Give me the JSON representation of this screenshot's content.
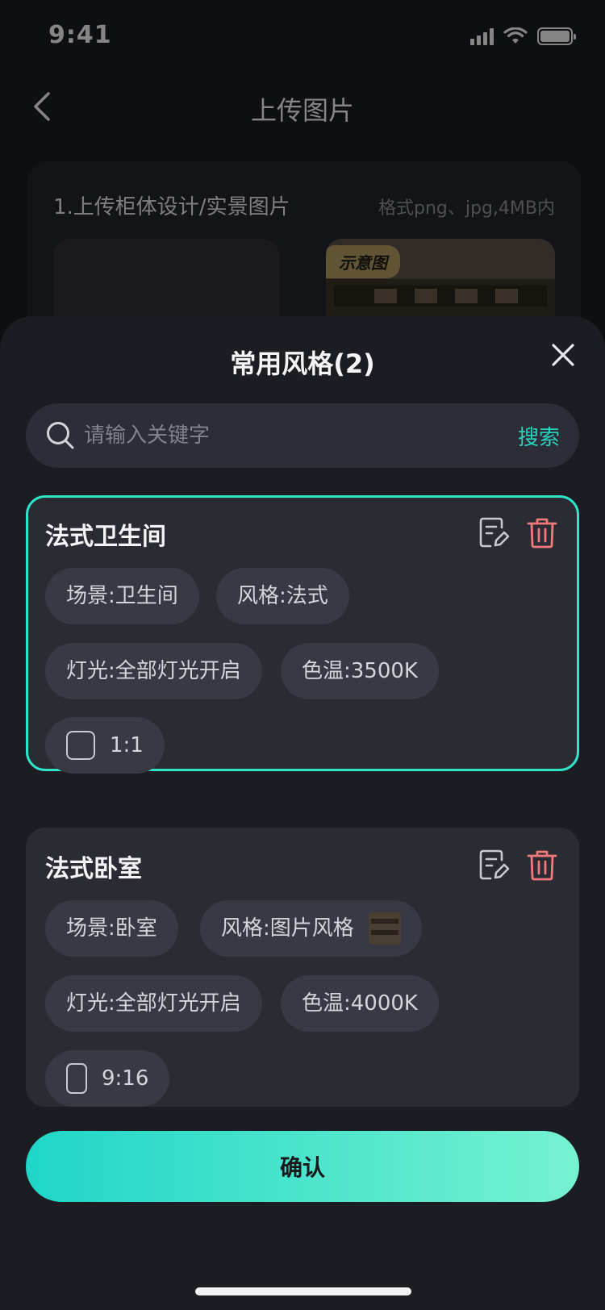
{
  "status_bar": {
    "time": "9:41"
  },
  "nav": {
    "title": "上传图片"
  },
  "upload": {
    "title": "1.上传柜体设计/实景图片",
    "hint": "格式png、jpg,4MB内",
    "sample_badge": "示意图"
  },
  "sheet": {
    "title": "常用风格(2)",
    "search": {
      "placeholder": "请输入关键字",
      "button": "搜索"
    },
    "confirm_label": "确认"
  },
  "styles": [
    {
      "name": "法式卫生间",
      "selected": true,
      "scene": "场景:卫生间",
      "style": "风格:法式",
      "lighting": "灯光:全部灯光开启",
      "color_temp": "色温:3500K",
      "ratio": "1:1"
    },
    {
      "name": "法式卧室",
      "selected": false,
      "scene": "场景:卧室",
      "style": "风格:图片风格",
      "lighting": "灯光:全部灯光开启",
      "color_temp": "色温:4000K",
      "ratio": "9:16"
    }
  ],
  "colors": {
    "accent": "#2ee5c9",
    "delete": "#f07a7a",
    "sheet_bg": "#1c1d23",
    "card_bg": "#2a2b33"
  },
  "icons": [
    "back-icon",
    "close-icon",
    "search-icon",
    "edit-icon",
    "delete-icon",
    "ratio-square-icon",
    "ratio-portrait-icon"
  ]
}
